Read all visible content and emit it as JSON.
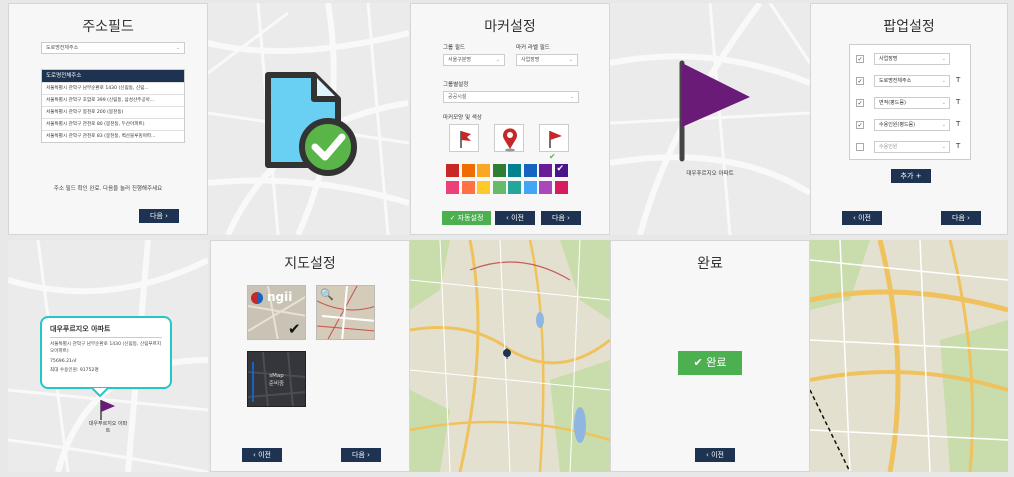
{
  "address": {
    "title": "주소필드",
    "select_value": "도로명전체주소",
    "list_header": "도로명전체주소",
    "rows": [
      "서울특별시 관악구 남부순환로 1430 (신림동, 신림...",
      "서울특별시 관악구 호암로 399 (신림동, 삼성산주공아...",
      "서울특별시 관악구 봉천로 200 (봉천동)",
      "서울특별시 관악구 관천로 80 (봉천동, 두산아파트)",
      "서울특별시 관악구 관천로 83 (봉천동, 벽산블루밍아파..."
    ],
    "message": "주소 필드 확인 완료. 다음을 눌러 진행해주세요",
    "next": "다음"
  },
  "marker": {
    "title": "마커설정",
    "group_field_label": "그룹 필드",
    "group_field_value": "서울구분명",
    "label_field_label": "마커 라벨 필드",
    "label_field_value": "사업장명",
    "group_setting_label": "그룹별설정",
    "group_setting_value": "공공시설",
    "shape_label": "마커모양 및 색상",
    "auto_label": "✓ 자동설정",
    "prev": "이전",
    "next": "다음",
    "palette": [
      "#c62828",
      "#ef6c00",
      "#f9a825",
      "#2e7d32",
      "#00838f",
      "#1565c0",
      "#6a1b9a",
      "#4a148c",
      "#ec407a",
      "#ff7043",
      "#ffca28",
      "#66bb6a",
      "#26a69a",
      "#42a5f5",
      "#ab47bc",
      "#d81b60"
    ]
  },
  "flag_preview": {
    "label": "대우푸르지오 아파트",
    "color": "#6a1b78"
  },
  "popup": {
    "title": "팝업설정",
    "fields": [
      {
        "label": "사업장명",
        "checked": true,
        "t": ""
      },
      {
        "label": "도로명전체주소",
        "checked": true,
        "t": "T"
      },
      {
        "label": "면적(평드뭄)",
        "checked": true,
        "t": "T"
      },
      {
        "label": "수용인원(평드뭄)",
        "checked": true,
        "t": "T"
      },
      {
        "label": "수용인원",
        "checked": false,
        "t": "T"
      }
    ],
    "add": "추가 +",
    "prev": "이전",
    "next": "다음"
  },
  "popup_preview": {
    "name": "대우푸르지오 아파트",
    "address": "서울특별시 관악구 남부순환로 1430 (신림동, 신림푸르지오아파트)",
    "area": "75696.21㎡",
    "capacity": "최대 수용인원: 91752명",
    "marker_label": "대우푸르지오 아파트"
  },
  "mapsetting": {
    "title": "지도설정",
    "option1": "ngii",
    "option3_line1": "sMap",
    "option3_line2": "준비중",
    "prev": "이전",
    "next": "다음"
  },
  "complete": {
    "title": "완료",
    "button": "✔ 완료",
    "prev": "이전"
  }
}
